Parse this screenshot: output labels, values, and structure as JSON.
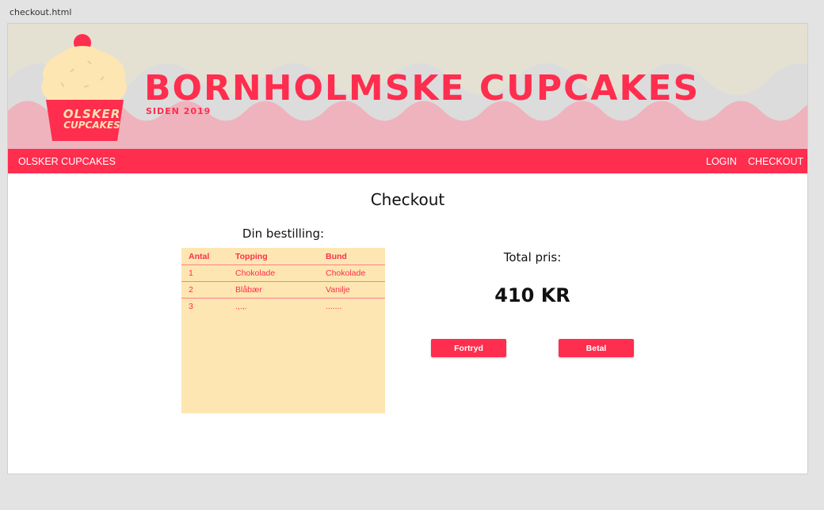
{
  "file_tab": "checkout.html",
  "header": {
    "title": "BORNHOLMSKE CUPCAKES",
    "subtitle": "SIDEN 2019",
    "logo_line1": "OLSKER",
    "logo_line2": "CUPCAKES"
  },
  "nav": {
    "brand": "OLSKER CUPCAKES",
    "login": "LOGIN",
    "checkout": "CHECKOUT"
  },
  "page": {
    "heading": "Checkout"
  },
  "order": {
    "heading": "Din bestilling:",
    "columns": [
      "Antal",
      "Topping",
      "Bund"
    ],
    "rows": [
      [
        "1",
        "Chokolade",
        "Chokolade"
      ],
      [
        "2",
        "Blåbær",
        "Vanilje"
      ],
      [
        "3",
        ".,.,.",
        "......."
      ]
    ]
  },
  "summary": {
    "total_label": "Total pris:",
    "total_value": "410 KR",
    "cancel_label": "Fortryd",
    "pay_label": "Betal"
  },
  "colors": {
    "brand_red": "#ff2d4e",
    "cream": "#fde6b2",
    "header_bg": "#e4e1d3",
    "wave_grey": "#dcdcdc",
    "wave_pink": "#efb3bd"
  }
}
